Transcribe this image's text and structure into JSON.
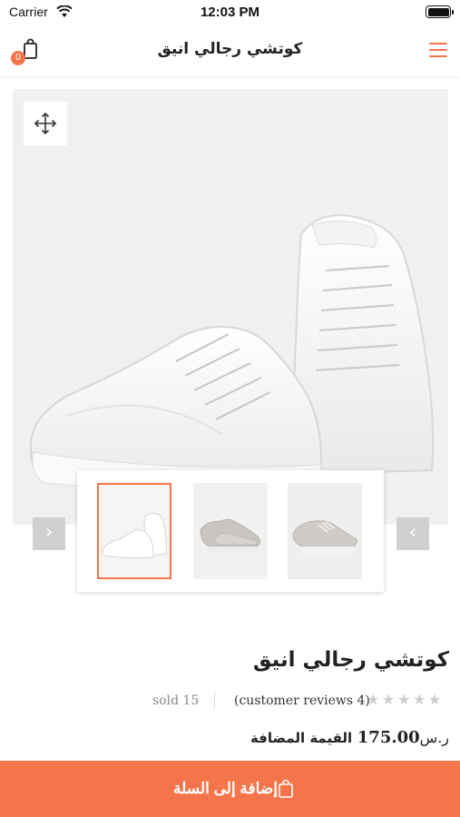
{
  "status_bar": {
    "carrier": "Carrier",
    "time": "12:03 PM",
    "wifi_icon": "wifi-icon",
    "battery_icon": "battery-icon"
  },
  "header": {
    "title": "كوتشي رجالي انيق",
    "cart_count": "0",
    "cart_icon": "shopping-bag-icon",
    "menu_icon": "hamburger-menu-icon",
    "accent_color": "#f4754b"
  },
  "gallery": {
    "expand_icon": "move-arrows-icon",
    "prev_arrow": "‹",
    "next_arrow": "›",
    "thumbnails": [
      {
        "name": "white-sneakers",
        "selected": true
      },
      {
        "name": "grey-sneakers",
        "selected": false
      },
      {
        "name": "grey-sneakers-alt",
        "selected": false
      }
    ]
  },
  "product": {
    "title": "كوتشي رجالي انيق",
    "sold": "sold 15",
    "reviews": "(customer reviews 4)",
    "rating": 0,
    "price_currency": "ر.س",
    "price_amount": "175.00",
    "price_note": "القيمة المضافة"
  },
  "actions": {
    "add_to_cart_label": "إضافة إلى السلة",
    "add_to_cart_icon": "shopping-bag-icon"
  }
}
